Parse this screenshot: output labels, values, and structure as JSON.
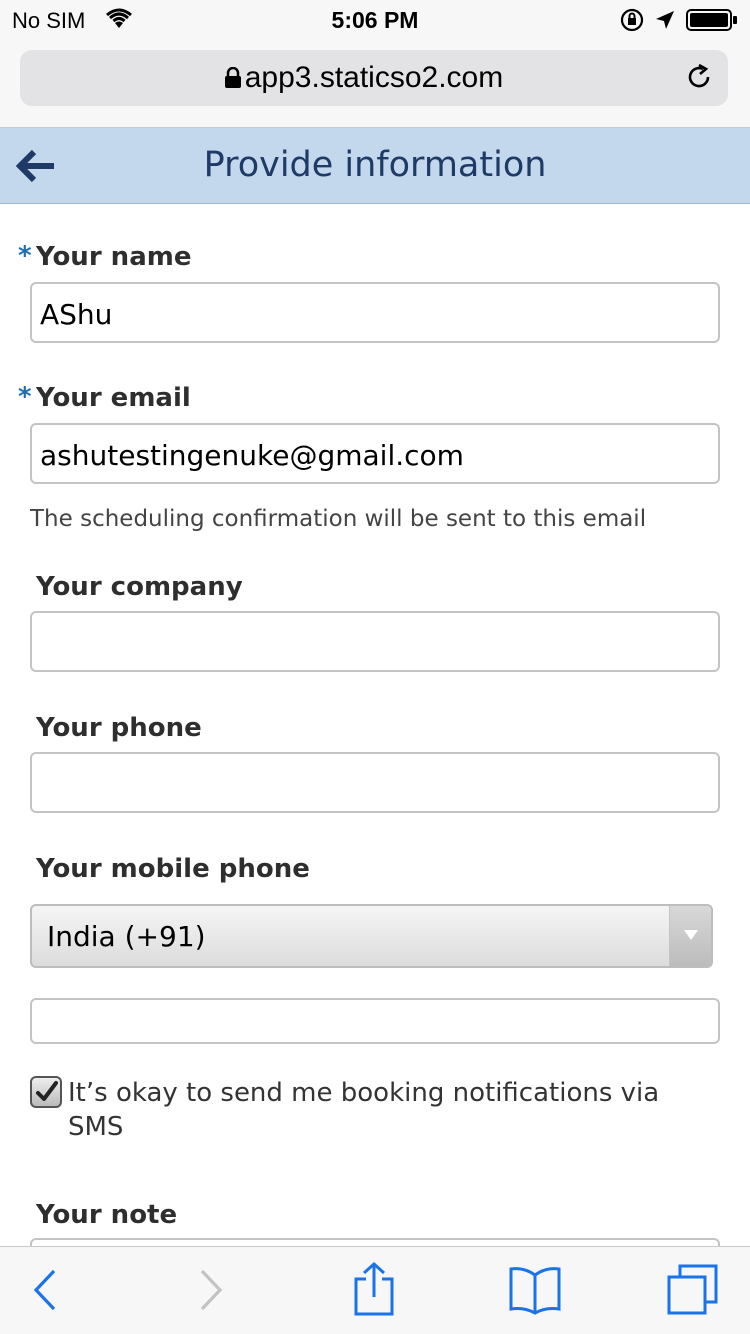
{
  "status_bar": {
    "carrier": "No SIM",
    "time": "5:06 PM"
  },
  "browser": {
    "url": "app3.staticso2.com"
  },
  "header": {
    "title": "Provide information"
  },
  "form": {
    "name_label": "Your name",
    "name_value": "AShu",
    "email_label": "Your email",
    "email_value": "ashutestingenuke@gmail.com",
    "email_hint": "The scheduling confirmation will be sent to this email",
    "company_label": "Your company",
    "company_value": "",
    "phone_label": "Your phone",
    "phone_value": "",
    "mobile_label": "Your mobile phone",
    "country_selected": "India (+91)",
    "mobile_value": "",
    "sms_consent_label": "It’s okay to send me booking notifications via SMS",
    "sms_consent_checked": true,
    "note_label": "Your note",
    "required_mark": "*"
  },
  "colors": {
    "header_bg": "#c3d8ec",
    "header_text": "#1f3a66",
    "ios_blue": "#1a73e8",
    "required": "#1f6fb0"
  },
  "icons": [
    "wifi-icon",
    "orientation-lock-icon",
    "location-icon",
    "battery-icon",
    "lock-icon",
    "reload-icon",
    "back-arrow-icon",
    "chevron-left-icon",
    "chevron-right-icon",
    "share-icon",
    "bookmarks-icon",
    "tabs-icon",
    "checkmark-icon",
    "chevron-down-icon"
  ]
}
